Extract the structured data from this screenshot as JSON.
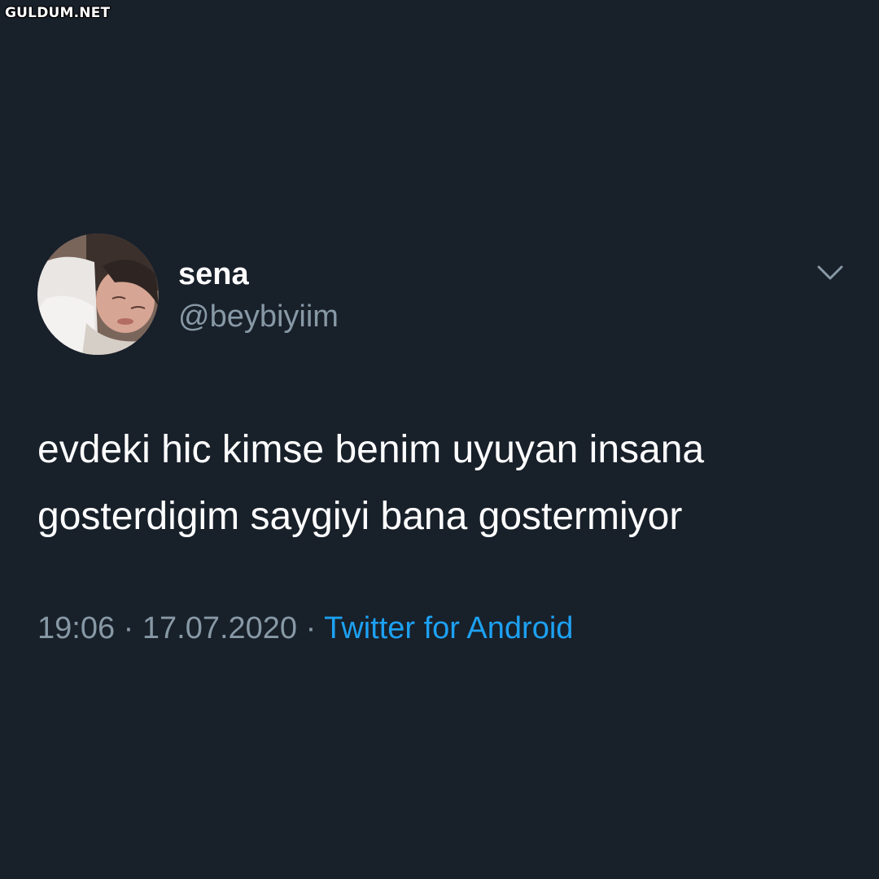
{
  "watermark": "GULDUM.NET",
  "tweet": {
    "display_name": "sena",
    "handle": "@beybiyiim",
    "text_lines": [
      "evdeki hic kimse benim uyuyan insana",
      "gosterdigim saygiyi bana gostermiyor"
    ],
    "time": "19:06",
    "date": "17.07.2020",
    "separator": "·",
    "source": "Twitter for Android"
  },
  "icons": {
    "menu": "chevron-down-icon",
    "avatar": "profile-photo"
  },
  "colors": {
    "background": "#18202a",
    "text_primary": "#ffffff",
    "text_secondary": "#8899a6",
    "link": "#1da1f2"
  }
}
